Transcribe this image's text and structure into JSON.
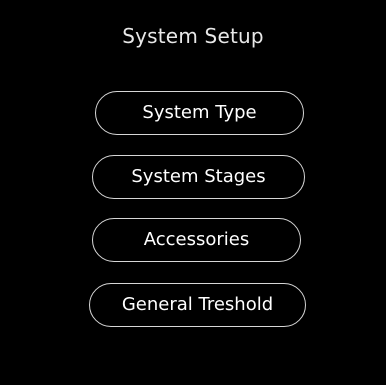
{
  "screen": {
    "title": "System Setup",
    "background": "#000000",
    "text_color": "#ffffff",
    "button_border_color": "#d6d6d6"
  },
  "menu": {
    "items": [
      {
        "label": "System Type"
      },
      {
        "label": "System Stages"
      },
      {
        "label": "Accessories"
      },
      {
        "label": "General Treshold"
      }
    ]
  }
}
